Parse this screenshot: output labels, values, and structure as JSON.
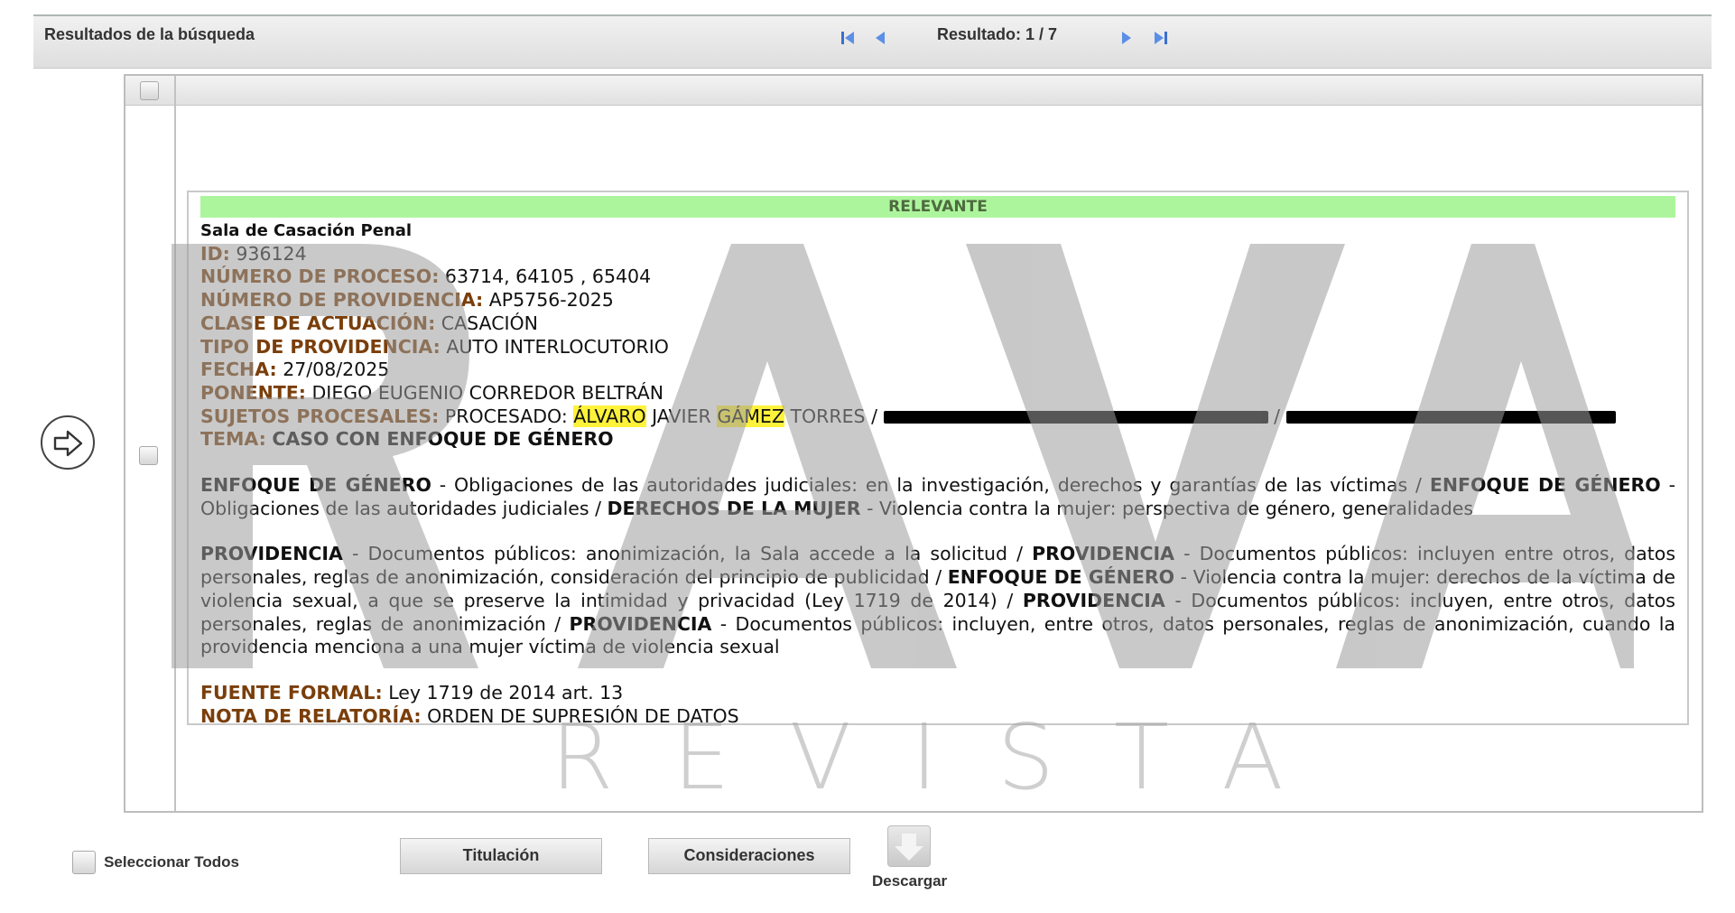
{
  "header": {
    "title": "Resultados de la búsqueda",
    "result_label": "Resultado: 1 / 7"
  },
  "record": {
    "relevance": "RELEVANTE",
    "sala": "Sala de Casación Penal",
    "fields": {
      "id": {
        "key": "ID:",
        "value": "936124"
      },
      "proceso": {
        "key": "NÚMERO DE PROCESO:",
        "value": "63714, 64105 , 65404"
      },
      "providencia": {
        "key": "NÚMERO DE PROVIDENCIA:",
        "value": "AP5756-2025"
      },
      "clase": {
        "key": "CLASE DE ACTUACIÓN:",
        "value": "CASACIÓN"
      },
      "tipo": {
        "key": "TIPO DE PROVIDENCIA:",
        "value": "AUTO INTERLOCUTORIO"
      },
      "fecha": {
        "key": "FECHA:",
        "value": "27/08/2025"
      },
      "ponente": {
        "key": "PONENTE:",
        "value": "DIEGO EUGENIO CORREDOR BELTRÁN"
      },
      "sujetos": {
        "key": "SUJETOS PROCESALES:",
        "pre": "PROCESADO:",
        "hl1": "ÁLVARO",
        "mid": "JAVIER",
        "hl2": "GÁMEZ",
        "post": "TORRES /",
        "sep": "/"
      },
      "tema": {
        "key": "TEMA:",
        "value": "CASO CON ENFOQUE DE GÉNERO"
      }
    },
    "para1": {
      "t1": "ENFOQUE DE GÉNERO",
      "d1": " - Obligaciones de las autoridades judiciales: en la investigación, derechos y garantías de las víctimas / ",
      "t2": "ENFOQUE DE GÉNERO",
      "d2": " - Obligaciones de las autoridades judiciales / ",
      "t3": "DERECHOS DE LA MUJER",
      "d3": " - Violencia contra la mujer: perspectiva de género, generalidades"
    },
    "para2": {
      "t1": "PROVIDENCIA",
      "d1": " - Documentos públicos: anonimización, la Sala accede a la solicitud / ",
      "t2": "PROVIDENCIA",
      "d2": " - Documentos públicos: incluyen entre otros, datos personales, reglas de anonimización, consideración del principio de publicidad / ",
      "t3": "ENFOQUE DE GÉNERO",
      "d3": " - Violencia contra la mujer: derechos de la víctima de violencia sexual, a que se preserve la intimidad y privacidad (Ley 1719 de 2014) / ",
      "t4": "PROVIDENCIA",
      "d4": " - Documentos públicos: incluyen, entre otros, datos personales, reglas de anonimización / ",
      "t5": "PROVIDENCIA",
      "d5": " - Documentos públicos: incluyen, entre otros, datos personales, reglas de anonimización, cuando la providencia menciona a una mujer víctima de violencia sexual"
    },
    "fuente": {
      "key": "FUENTE FORMAL:",
      "value": "Ley 1719 de 2014 art. 13"
    },
    "nota": {
      "key": "NOTA DE RELATORÍA:",
      "value": "ORDEN DE SUPRESIÓN DE DATOS"
    }
  },
  "footer": {
    "select_all": "Seleccionar Todos",
    "btn_titulacion": "Titulación",
    "btn_consideraciones": "Consideraciones",
    "download": "Descargar"
  },
  "watermark": {
    "big": "RAVA",
    "word": "REVISTA"
  },
  "colors": {
    "field_key": "#7a3e0a",
    "relevance_bg": "#adf59d",
    "highlight": "#fff23a"
  }
}
